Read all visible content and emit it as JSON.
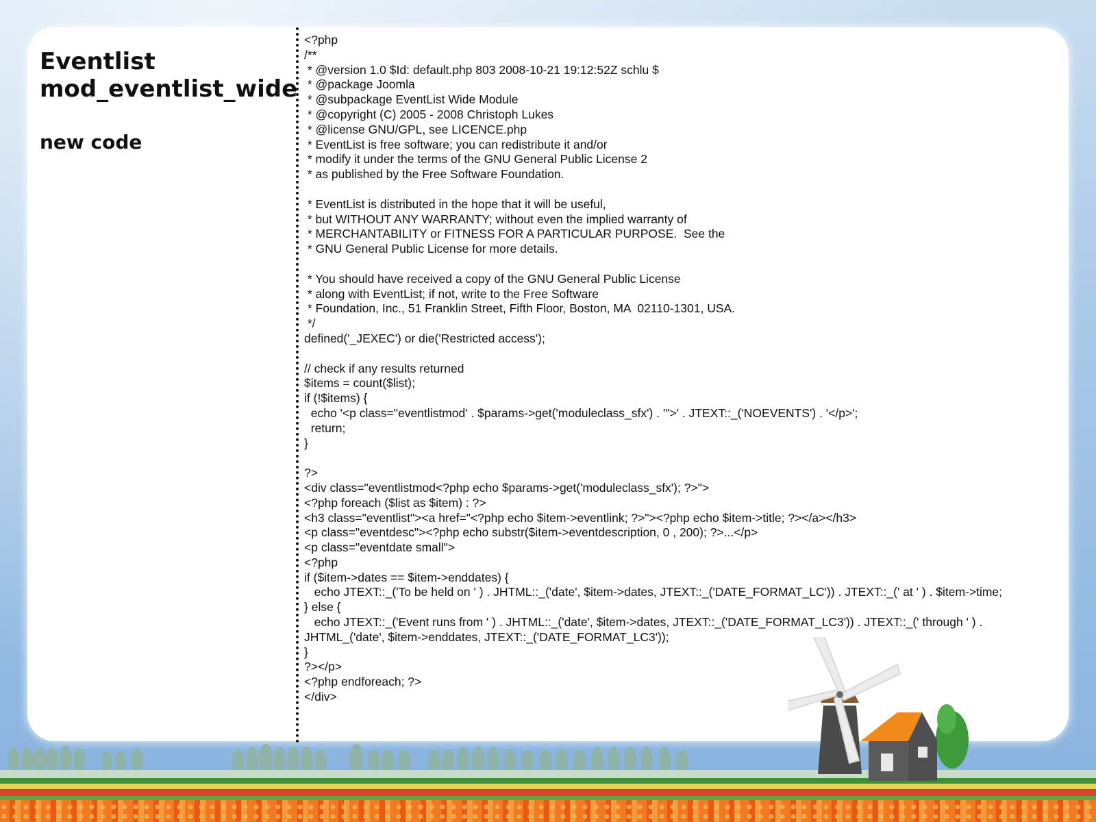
{
  "slide": {
    "title_lines": [
      "Eventlist",
      "mod_eventlist_wide"
    ],
    "subtitle": "new code"
  },
  "code_lines": [
    "<?php",
    "/**",
    " * @version 1.0 $Id: default.php 803 2008-10-21 19:12:52Z schlu $",
    " * @package Joomla",
    " * @subpackage EventList Wide Module",
    " * @copyright (C) 2005 - 2008 Christoph Lukes",
    " * @license GNU/GPL, see LICENCE.php",
    " * EventList is free software; you can redistribute it and/or",
    " * modify it under the terms of the GNU General Public License 2",
    " * as published by the Free Software Foundation.",
    "",
    " * EventList is distributed in the hope that it will be useful,",
    " * but WITHOUT ANY WARRANTY; without even the implied warranty of",
    " * MERCHANTABILITY or FITNESS FOR A PARTICULAR PURPOSE.  See the",
    " * GNU General Public License for more details.",
    "",
    " * You should have received a copy of the GNU General Public License",
    " * along with EventList; if not, write to the Free Software",
    " * Foundation, Inc., 51 Franklin Street, Fifth Floor, Boston, MA  02110-1301, USA.",
    " */",
    "defined('_JEXEC') or die('Restricted access');",
    "",
    "// check if any results returned",
    "$items = count($list);",
    "if (!$items) {",
    "  echo '<p class=\"eventlistmod' . $params->get('moduleclass_sfx') . '\">' . JTEXT::_('NOEVENTS') . '</p>';",
    "  return;",
    "}",
    "",
    "?>",
    "<div class=\"eventlistmod<?php echo $params->get('moduleclass_sfx'); ?>\">",
    "<?php foreach ($list as $item) : ?>",
    "<h3 class=\"eventlist\"><a href=\"<?php echo $item->eventlink; ?>\"><?php echo $item->title; ?></a></h3>",
    "<p class=\"eventdesc\"><?php echo substr($item->eventdescription, 0 , 200); ?>...</p>",
    "<p class=\"eventdate small\">",
    "<?php",
    "if ($item->dates == $item->enddates) {",
    "   echo JTEXT::_('To be held on ' ) . JHTML::_('date', $item->dates, JTEXT::_('DATE_FORMAT_LC')) . JTEXT::_(' at ' ) . $item->time;",
    "} else {",
    "   echo JTEXT::_('Event runs from ' ) . JHTML::_('date', $item->dates, JTEXT::_('DATE_FORMAT_LC3')) . JTEXT::_(' through ' ) .",
    "JHTML_('date', $item->enddates, JTEXT::_('DATE_FORMAT_LC3'));",
    "}",
    "?></p>",
    "<?php endforeach; ?>",
    "</div>"
  ],
  "colors": {
    "card": "#ffffff",
    "text": "#111111",
    "sky": "#a9c8e8",
    "roof": "#f08a1a",
    "tulips": "#f07a1f"
  }
}
